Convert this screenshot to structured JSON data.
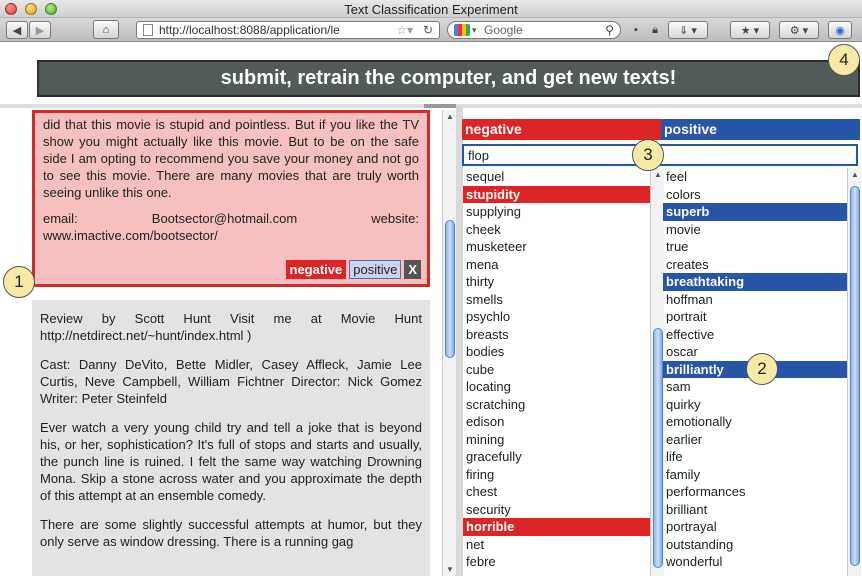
{
  "window": {
    "title": "Text Classification Experiment"
  },
  "toolbar": {
    "url": "http://localhost:8088/application/le",
    "url_host_bold": "localhost",
    "search_placeholder": "Google"
  },
  "submit_button": {
    "label": "submit, retrain the computer, and get new texts!"
  },
  "review1": {
    "paragraph1": "did that this movie is stupid and pointless. But if you like the TV show you might actually like this movie. But to be on the safe side I am opting to recommend you save your money and not go to see this movie. There are many movies that are truly worth seeing unlike this one.",
    "email_label": "email:",
    "email_value": "Bootsector@hotmail.com",
    "website_label": "website:",
    "website_value": "www.imactive.com/bootsector/",
    "buttons": {
      "negative": "negative",
      "positive": "positive",
      "remove": "X"
    },
    "label": "negative",
    "highlight_color": "#dd2525"
  },
  "review2": {
    "paragraph1": "Review by Scott Hunt Visit me at Movie Hunt http://netdirect.net/~hunt/index.html )",
    "paragraph2": "Cast: Danny DeVito, Bette Midler, Casey Affleck, Jamie Lee Curtis, Neve Campbell, William Fichtner Director: Nick Gomez Writer: Peter Steinfeld",
    "paragraph3": "Ever watch a very young child try and tell a joke that is beyond his, or her, sophistication? It's full of stops and starts and usually, the punch line is ruined. I felt the same way watching Drowning Mona. Skip a stone across water and you approximate the depth of this attempt at an ensemble comedy.",
    "paragraph4": "There are some slightly successful attempts at humor, but they only serve as window dressing. There is a running gag"
  },
  "columns": {
    "negative_header": "negative",
    "positive_header": "positive",
    "negative_color": "#dd2525",
    "positive_color": "#2755a8"
  },
  "filter": {
    "value": "flop"
  },
  "negative_words": [
    {
      "text": "sequel",
      "highlighted": false
    },
    {
      "text": "stupidity",
      "highlighted": true
    },
    {
      "text": "supplying",
      "highlighted": false
    },
    {
      "text": "cheek",
      "highlighted": false
    },
    {
      "text": "musketeer",
      "highlighted": false
    },
    {
      "text": "mena",
      "highlighted": false
    },
    {
      "text": "thirty",
      "highlighted": false
    },
    {
      "text": "smells",
      "highlighted": false
    },
    {
      "text": "psychlo",
      "highlighted": false
    },
    {
      "text": "breasts",
      "highlighted": false
    },
    {
      "text": "bodies",
      "highlighted": false
    },
    {
      "text": "cube",
      "highlighted": false
    },
    {
      "text": "locating",
      "highlighted": false
    },
    {
      "text": "scratching",
      "highlighted": false
    },
    {
      "text": "edison",
      "highlighted": false
    },
    {
      "text": "mining",
      "highlighted": false
    },
    {
      "text": "gracefully",
      "highlighted": false
    },
    {
      "text": "firing",
      "highlighted": false
    },
    {
      "text": "chest",
      "highlighted": false
    },
    {
      "text": "security",
      "highlighted": false
    },
    {
      "text": "horrible",
      "highlighted": true
    },
    {
      "text": "net",
      "highlighted": false
    },
    {
      "text": "febre",
      "highlighted": false
    }
  ],
  "positive_words": [
    {
      "text": "feel",
      "highlighted": false
    },
    {
      "text": "colors",
      "highlighted": false
    },
    {
      "text": "superb",
      "highlighted": true
    },
    {
      "text": "movie",
      "highlighted": false
    },
    {
      "text": "true",
      "highlighted": false
    },
    {
      "text": "creates",
      "highlighted": false
    },
    {
      "text": "breathtaking",
      "highlighted": true
    },
    {
      "text": "hoffman",
      "highlighted": false
    },
    {
      "text": "portrait",
      "highlighted": false
    },
    {
      "text": "effective",
      "highlighted": false
    },
    {
      "text": "oscar",
      "highlighted": false
    },
    {
      "text": "brilliantly",
      "highlighted": true
    },
    {
      "text": "sam",
      "highlighted": false
    },
    {
      "text": "quirky",
      "highlighted": false
    },
    {
      "text": "emotionally",
      "highlighted": false
    },
    {
      "text": "earlier",
      "highlighted": false
    },
    {
      "text": "life",
      "highlighted": false
    },
    {
      "text": "family",
      "highlighted": false
    },
    {
      "text": "performances",
      "highlighted": false
    },
    {
      "text": "brilliant",
      "highlighted": false
    },
    {
      "text": "portrayal",
      "highlighted": false
    },
    {
      "text": "outstanding",
      "highlighted": false
    },
    {
      "text": "wonderful",
      "highlighted": false
    }
  ],
  "callouts": [
    "1",
    "2",
    "3",
    "4"
  ]
}
